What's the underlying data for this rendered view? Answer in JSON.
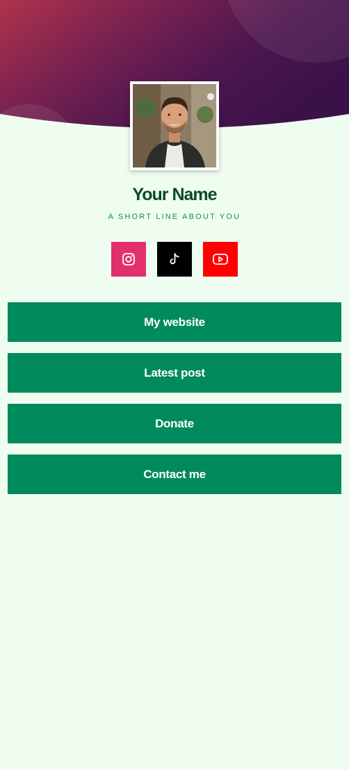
{
  "profile": {
    "name": "Your Name",
    "tagline": "A SHORT LINE ABOUT YOU"
  },
  "socials": [
    {
      "network": "Instagram",
      "icon": "instagram-icon",
      "color": "#e1306c"
    },
    {
      "network": "TikTok",
      "icon": "tiktok-icon",
      "color": "#000000"
    },
    {
      "network": "YouTube",
      "icon": "youtube-icon",
      "color": "#ff0000"
    }
  ],
  "links": [
    {
      "label": "My website"
    },
    {
      "label": "Latest post"
    },
    {
      "label": "Donate"
    },
    {
      "label": "Contact me"
    }
  ],
  "colors": {
    "background": "#effdf1",
    "button": "#018a5b",
    "name_text": "#0b4a2b",
    "tagline_text": "#138a57",
    "header_gradient_start": "#b0334b",
    "header_gradient_end": "#3a1248"
  }
}
